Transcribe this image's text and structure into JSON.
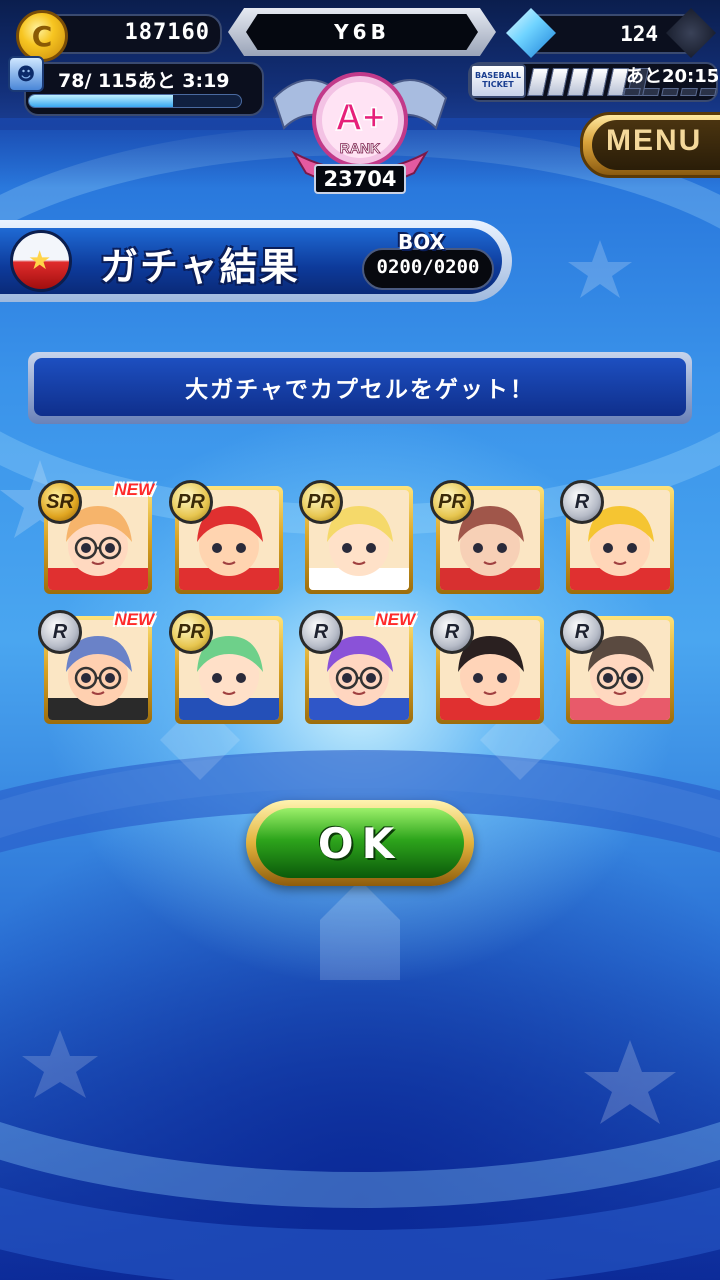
{
  "header": {
    "coins": "187160",
    "player_name": "Y6B",
    "gems": "124",
    "stamina": {
      "text": "78/ 115あと  3:19",
      "fill_fraction": 0.68
    },
    "ticket": {
      "icon_label_top": "BASEBALL",
      "icon_label_bottom": "TICKET",
      "filled_slots": 5,
      "total_slots": 6,
      "timer": "あと20:15"
    },
    "rank": {
      "grade": "A+",
      "label": "RANK",
      "score": "23704"
    },
    "menu_label": "MENU"
  },
  "title": {
    "text": "ガチャ結果",
    "box_label": "BOX",
    "box_value": "0200/0200"
  },
  "message": "大ガチャでカプセルをゲット！",
  "results": [
    {
      "rarity": "SR",
      "new": "NEW",
      "hair": "#f6b46b",
      "skin": "#ffd9c0",
      "uniform": "#e03030",
      "glasses": true
    },
    {
      "rarity": "PR",
      "new": "",
      "hair": "#e03030",
      "skin": "#ffd4b0",
      "uniform": "#e03030",
      "glasses": false
    },
    {
      "rarity": "PR",
      "new": "",
      "hair": "#f5d96a",
      "skin": "#ffe1c8",
      "uniform": "#ffffff",
      "glasses": false
    },
    {
      "rarity": "PR",
      "new": "",
      "hair": "#a0564a",
      "skin": "#f7d0b6",
      "uniform": "#d83030",
      "glasses": false
    },
    {
      "rarity": "R",
      "new": "",
      "hair": "#f5c532",
      "skin": "#ffd6b8",
      "uniform": "#e03030",
      "glasses": false
    },
    {
      "rarity": "R",
      "new": "NEW",
      "hair": "#6a82c8",
      "skin": "#ffd0b0",
      "uniform": "#2a2a2a",
      "glasses": true
    },
    {
      "rarity": "PR",
      "new": "",
      "hair": "#6ed08a",
      "skin": "#ffe0c8",
      "uniform": "#2450b8",
      "glasses": false
    },
    {
      "rarity": "R",
      "new": "NEW",
      "hair": "#8a52d8",
      "skin": "#ffd6c0",
      "uniform": "#2f56c8",
      "glasses": true
    },
    {
      "rarity": "R",
      "new": "",
      "hair": "#2a2020",
      "skin": "#ffd4b8",
      "uniform": "#e03030",
      "glasses": false
    },
    {
      "rarity": "R",
      "new": "",
      "hair": "#5a4a40",
      "skin": "#ffd8c0",
      "uniform": "#e85a6a",
      "glasses": true
    }
  ],
  "ok_button": "OK"
}
